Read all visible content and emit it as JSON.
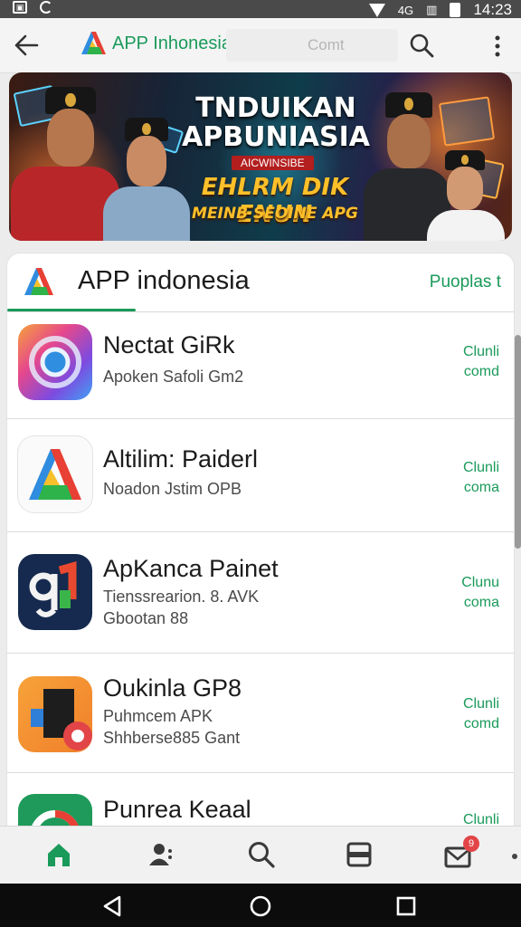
{
  "status_bar": {
    "left_icons": [
      "screenshot-icon",
      "sync-icon"
    ],
    "right_icons": [
      "wifi-icon",
      "signal-icon",
      "vibrate-icon",
      "battery-icon"
    ],
    "network_label": "4G",
    "time": "14:23"
  },
  "app_bar": {
    "title": "APP Inhonesia",
    "search_placeholder": "Comt",
    "icons": [
      "back-arrow-icon",
      "app-logo-icon",
      "search-icon",
      "more-vert-icon"
    ]
  },
  "banner": {
    "headline": "TNDUIKAN APBUNIASIA",
    "tag": "AICWINSIBE",
    "line1": "EHLRM DIK ENUN",
    "line2": "MEINB SEOINE APG"
  },
  "list": {
    "header_title": "APP indonesia",
    "header_action": "Puoplas t",
    "accent_color": "#1a9a5a",
    "items": [
      {
        "title": "Nectat GiRk",
        "lines": [
          "Apoken Safoli Gm2"
        ],
        "action": [
          "Clunli",
          "comd"
        ],
        "icon": "chrome-like-icon"
      },
      {
        "title": "Altilim: Paiderl",
        "lines": [
          "Noadon Jstim OPB"
        ],
        "action": [
          "Clunli",
          "coma"
        ],
        "icon": "triangle-logo-icon"
      },
      {
        "title": "ApKanca Painet",
        "lines": [
          "Tienssrearion. 8. AVK",
          "Gbootan 88"
        ],
        "action": [
          "Clunu",
          "coma"
        ],
        "icon": "music-note-icon"
      },
      {
        "title": "Oukinla GP8",
        "lines": [
          "Puhmcem APK",
          "Shhberse885 Gant"
        ],
        "action": [
          "Clunli",
          "comd"
        ],
        "icon": "square-badge-icon"
      },
      {
        "title": "Punrea Keaal",
        "lines": [],
        "action": [
          "Clunli"
        ],
        "icon": "google-like-icon"
      }
    ]
  },
  "bottom_nav": {
    "items": [
      "home-icon",
      "people-icon",
      "search-icon",
      "apps-icon",
      "mail-icon"
    ],
    "badge": "9"
  },
  "system_nav": [
    "back-triangle-icon",
    "home-circle-icon",
    "recents-square-icon"
  ]
}
